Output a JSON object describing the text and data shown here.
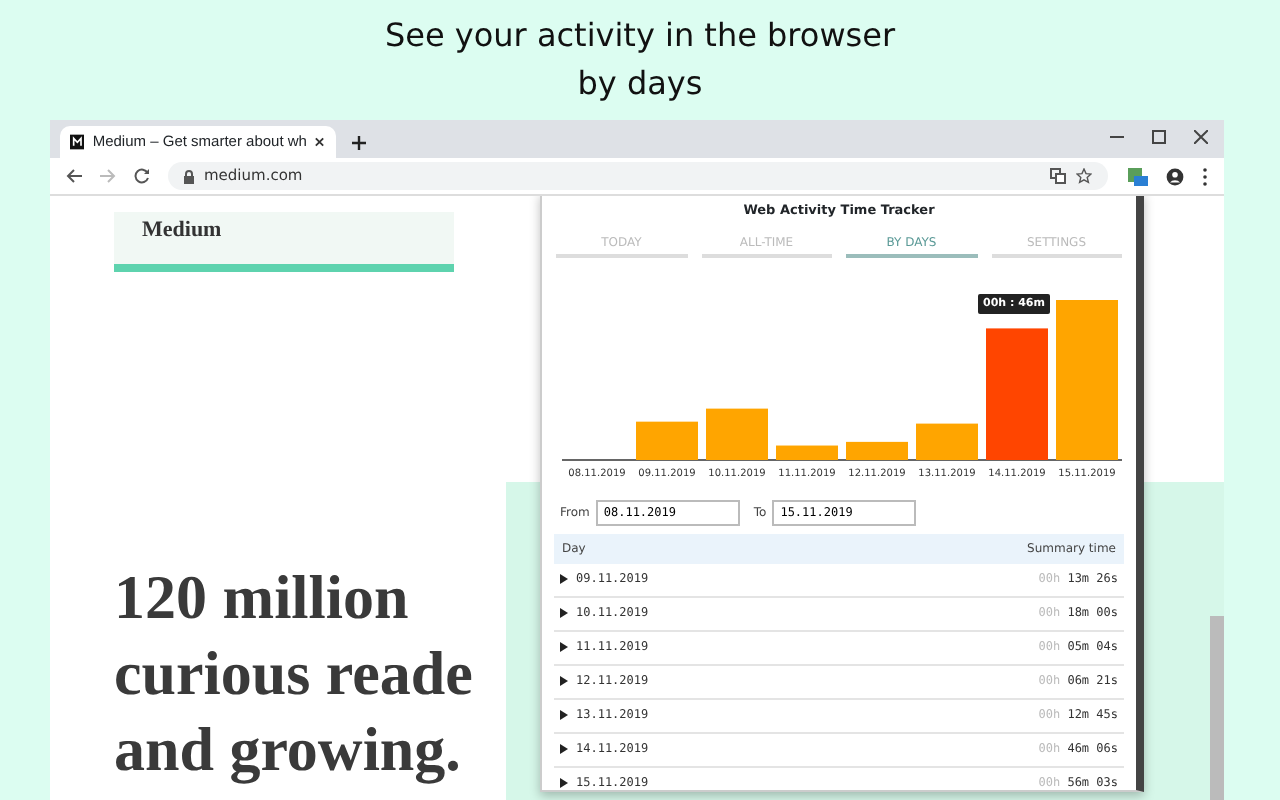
{
  "caption": "See your activity in the browser by days",
  "browser": {
    "tab_title": "Medium – Get smarter about wh",
    "url": "medium.com"
  },
  "page": {
    "logo": "Medium",
    "headline_lines": [
      "120 million",
      "curious reade",
      "and growing."
    ]
  },
  "popup": {
    "title": "Web Activity Time Tracker",
    "tabs": [
      {
        "label": "TODAY",
        "selected": false
      },
      {
        "label": "ALL-TIME",
        "selected": false
      },
      {
        "label": "BY DAYS",
        "selected": true
      },
      {
        "label": "SETTINGS",
        "selected": false
      }
    ],
    "chart": {
      "tooltip": "00h : 46m",
      "bars": [
        {
          "label": "08.11.2019",
          "selected": false
        },
        {
          "label": "09.11.2019",
          "selected": false
        },
        {
          "label": "10.11.2019",
          "selected": false
        },
        {
          "label": "11.11.2019",
          "selected": false
        },
        {
          "label": "12.11.2019",
          "selected": false
        },
        {
          "label": "13.11.2019",
          "selected": false
        },
        {
          "label": "14.11.2019",
          "selected": true
        },
        {
          "label": "15.11.2019",
          "selected": false
        }
      ]
    },
    "filter": {
      "from_label": "From",
      "from": "08.11.2019",
      "to_label": "To",
      "to": "15.11.2019"
    },
    "table": {
      "columns": [
        "Day",
        "Summary time"
      ],
      "rows": [
        {
          "day": "09.11.2019",
          "hours": "00h",
          "rest": "13m 26s",
          "expanded": false
        },
        {
          "day": "10.11.2019",
          "hours": "00h",
          "rest": "18m 00s",
          "expanded": false
        },
        {
          "day": "11.11.2019",
          "hours": "00h",
          "rest": "05m 04s",
          "expanded": false
        },
        {
          "day": "12.11.2019",
          "hours": "00h",
          "rest": "06m 21s",
          "expanded": false
        },
        {
          "day": "13.11.2019",
          "hours": "00h",
          "rest": "12m 45s",
          "expanded": false
        },
        {
          "day": "14.11.2019",
          "hours": "00h",
          "rest": "46m 06s",
          "expanded": false
        },
        {
          "day": "15.11.2019",
          "hours": "00h",
          "rest": "56m 03s",
          "expanded": false
        }
      ]
    }
  }
}
